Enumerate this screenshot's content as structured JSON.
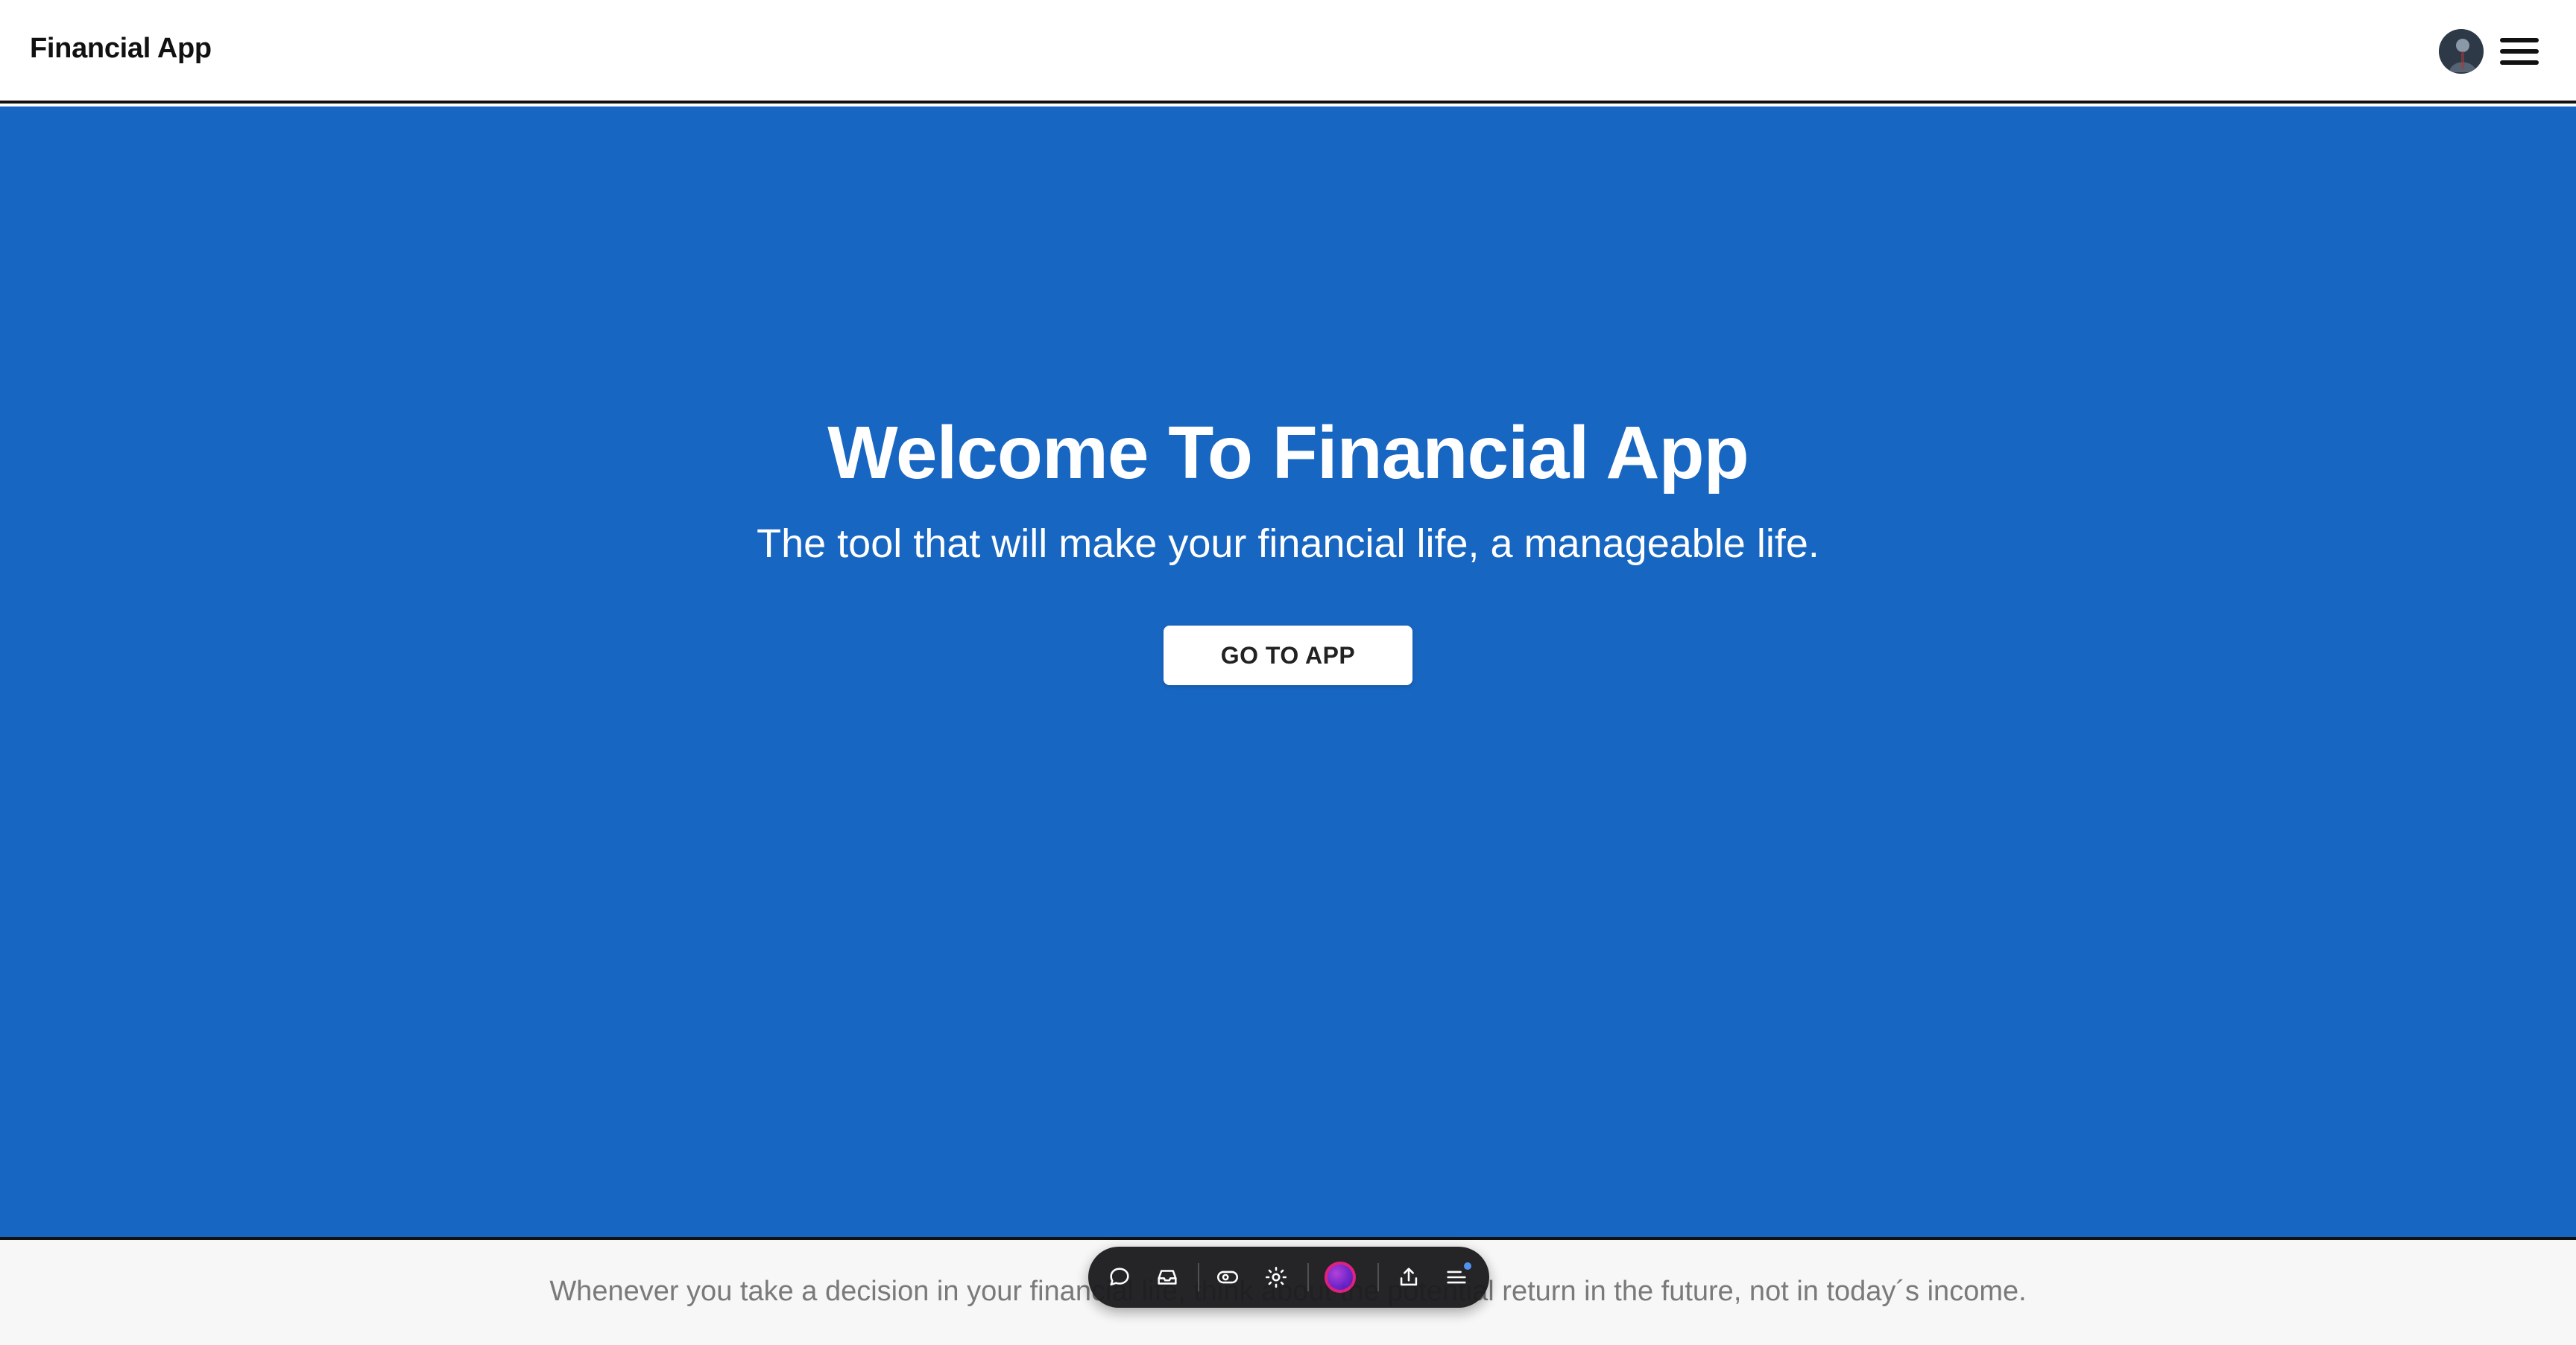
{
  "header": {
    "brand": "Financial App"
  },
  "hero": {
    "title": "Welcome To Financial App",
    "subtitle": "The tool that will make your financial life, a manageable life.",
    "cta_label": "GO TO APP",
    "background_color": "#1766c2"
  },
  "footer": {
    "quote": "Whenever you take a decision in your financial life, think about the potential return in the future, not in today´s income."
  },
  "toolbar": {
    "buttons": [
      {
        "icon": "comment-icon"
      },
      {
        "icon": "inbox-icon"
      },
      {
        "icon": "eye-icon"
      },
      {
        "icon": "settings-icon"
      },
      {
        "icon": "record-icon"
      },
      {
        "icon": "share-icon"
      },
      {
        "icon": "menu-list-icon"
      }
    ]
  },
  "colors": {
    "accent": "#1766c2",
    "record_ring": "#e0197a",
    "notification_dot": "#4a8ef0"
  }
}
